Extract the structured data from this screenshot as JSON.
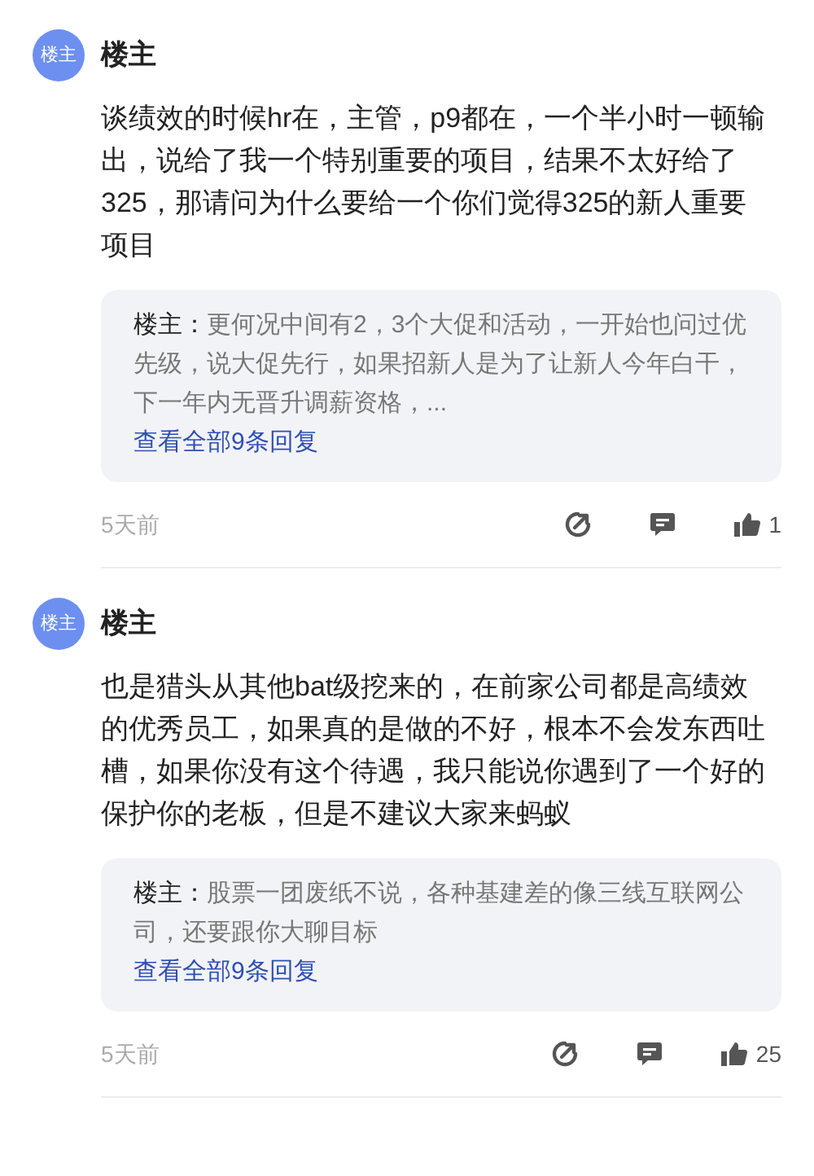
{
  "comments": [
    {
      "avatar": "楼主",
      "author": "楼主",
      "body": "谈绩效的时候hr在，主管，p9都在，一个半小时一顿输出，说给了我一个特别重要的项目，结果不太好给了325，那请问为什么要给一个你们觉得325的新人重要项目",
      "reply": {
        "author": "楼主：",
        "text": "更何况中间有2，3个大促和活动，一开始也问过优先级，说大促先行，如果招新人是为了让新人今年白干，下一年内无晋升调薪资格，...",
        "more": "查看全部9条回复"
      },
      "time": "5天前",
      "likes": "1"
    },
    {
      "avatar": "楼主",
      "author": "楼主",
      "body": "也是猎头从其他bat级挖来的，在前家公司都是高绩效的优秀员工，如果真的是做的不好，根本不会发东西吐槽，如果你没有这个待遇，我只能说你遇到了一个好的保护你的老板，但是不建议大家来蚂蚁",
      "reply": {
        "author": "楼主：",
        "text": "股票一团废纸不说，各种基建差的像三线互联网公司，还要跟你大聊目标",
        "more": "查看全部9条回复"
      },
      "time": "5天前",
      "likes": "25"
    }
  ]
}
